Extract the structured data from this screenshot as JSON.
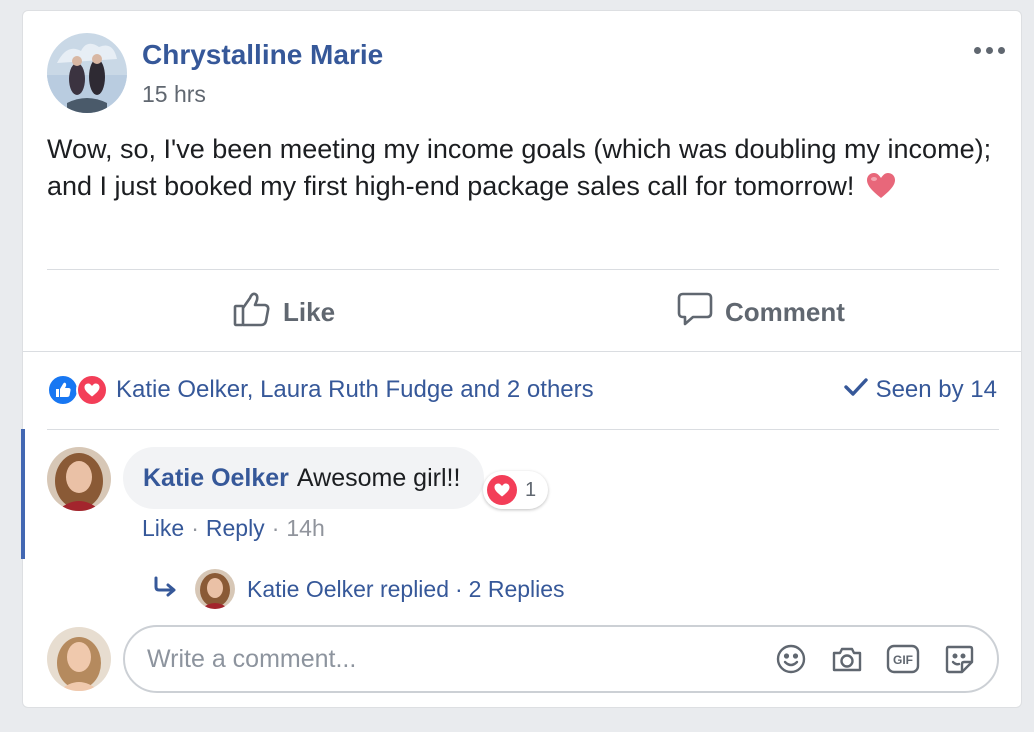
{
  "post": {
    "author": "Chrystalline Marie",
    "time": "15 hrs",
    "text": "Wow, so, I've been meeting my income goals (which was doubling my income); and I just booked my first high-end package sales call for tomorrow!",
    "emoji": "heart-emoji"
  },
  "actions": {
    "like_label": "Like",
    "comment_label": "Comment"
  },
  "reactions": {
    "names": "Katie Oelker, Laura Ruth Fudge and 2 others",
    "seen": "Seen by 14",
    "icons": [
      "like-icon",
      "love-icon"
    ]
  },
  "comment": {
    "author": "Katie Oelker",
    "text": "Awesome girl!!",
    "reaction_count": "1",
    "like_label": "Like",
    "reply_label": "Reply",
    "time": "14h",
    "separator": "·"
  },
  "replies": {
    "author_text": "Katie Oelker replied",
    "separator": "·",
    "count_text": "2 Replies"
  },
  "composer": {
    "placeholder": "Write a comment...",
    "tools": [
      "emoji-icon",
      "camera-icon",
      "gif-icon",
      "sticker-icon"
    ]
  },
  "colors": {
    "link": "#365899",
    "like_blue": "#1877f2",
    "love_red": "#f33e58",
    "highlight": "#4267b2"
  }
}
